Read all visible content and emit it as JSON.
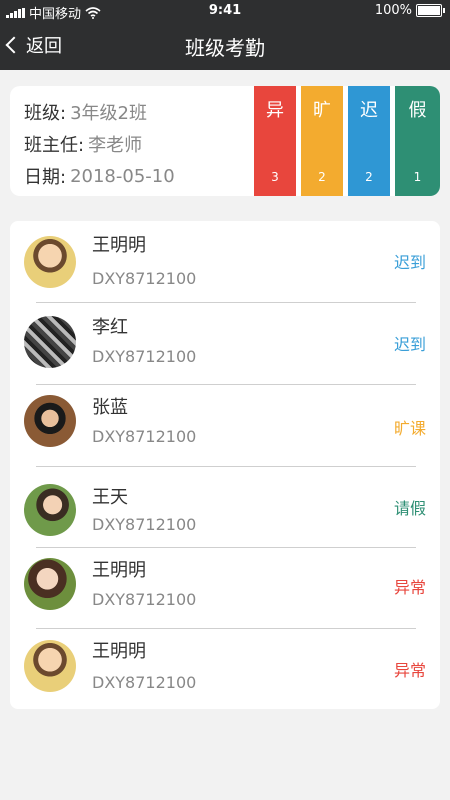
{
  "statusbar": {
    "carrier": "中国移动",
    "time": "9:41",
    "battery": "100%"
  },
  "nav": {
    "back_label": "返回",
    "title": "班级考勤"
  },
  "info": {
    "class_label": "班级:",
    "class_value": "3年级2班",
    "teacher_label": "班主任:",
    "teacher_value": "李老师",
    "date_label": "日期:",
    "date_value": "2018-05-10"
  },
  "stats": [
    {
      "label": "异",
      "count": "3",
      "color": "#e8463d"
    },
    {
      "label": "旷",
      "count": "2",
      "color": "#f3ab2f"
    },
    {
      "label": "迟",
      "count": "2",
      "color": "#2f97d4"
    },
    {
      "label": "假",
      "count": "1",
      "color": "#2e8f74"
    }
  ],
  "students": [
    {
      "name": "王明明",
      "id": "DXY8712100",
      "status": "迟到",
      "status_color": "#3b9fd8"
    },
    {
      "name": "李红",
      "id": "DXY8712100",
      "status": "迟到",
      "status_color": "#3b9fd8"
    },
    {
      "name": "张蓝",
      "id": "DXY8712100",
      "status": "旷课",
      "status_color": "#f3ab2f"
    },
    {
      "name": "王天",
      "id": "DXY8712100",
      "status": "请假",
      "status_color": "#2e8f74"
    },
    {
      "name": "王明明",
      "id": "DXY8712100",
      "status": "异常",
      "status_color": "#e8463d"
    },
    {
      "name": "王明明",
      "id": "DXY8712100",
      "status": "异常",
      "status_color": "#e8463d"
    }
  ]
}
